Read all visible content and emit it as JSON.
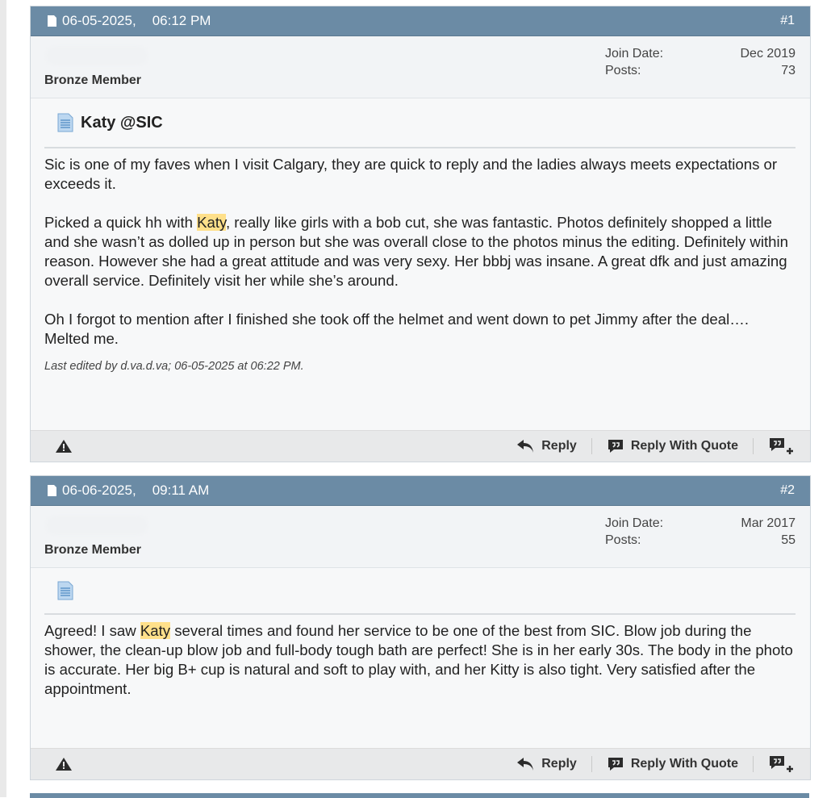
{
  "posts": [
    {
      "date": "06-05-2025,",
      "time": "06:12 PM",
      "number": "#1",
      "rank": "Bronze Member",
      "join_label": "Join Date:",
      "join_value": "Dec 2019",
      "posts_label": "Posts:",
      "posts_value": "73",
      "title": "Katy @SIC",
      "p1": "Sic is one of my faves when I visit Calgary, they are quick to reply and the ladies always meets expectations or exceeds it.",
      "p2_before": "Picked a quick hh with ",
      "p2_highlight": "Katy",
      "p2_after": ", really like girls with a bob cut, she was fantastic. Photos definitely shopped a little and she wasn’t as dolled up in person but she was overall close to the photos minus the editing. Definitely within reason. However she had a great attitude and was very sexy. Her bbbj was insane. A great dfk and just amazing overall service. Definitely visit her while she’s around.",
      "p3": "Oh I forgot to mention after I finished she took off the helmet and went down to pet Jimmy after the deal…. Melted me.",
      "edited": "Last edited by d.va.d.va; 06-05-2025 at 06:22 PM."
    },
    {
      "date": "06-06-2025,",
      "time": "09:11 AM",
      "number": "#2",
      "rank": "Bronze Member",
      "join_label": "Join Date:",
      "join_value": "Mar 2017",
      "posts_label": "Posts:",
      "posts_value": "55",
      "p1_before": "Agreed! I saw ",
      "p1_highlight": "Katy",
      "p1_after": " several times and found her service to be one of the best from SIC. Blow job during the shower, the clean-up blow job and full-body tough bath are perfect! She is in her early 30s. The body in the photo is accurate. Her big B+ cup is natural and soft to play with, and her Kitty is also tight. Very satisfied after the appointment."
    }
  ],
  "actions": {
    "reply": "Reply",
    "reply_quote": "Reply With Quote"
  },
  "colors": {
    "header": "#6b8ba5",
    "highlight": "#ffe08a"
  },
  "icons": [
    "document-icon",
    "report-icon",
    "reply-icon",
    "quote-icon",
    "multi-quote-icon"
  ]
}
